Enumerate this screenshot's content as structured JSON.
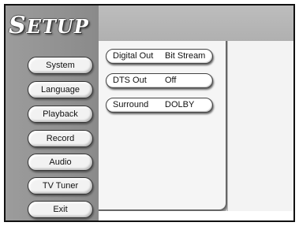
{
  "title": {
    "first": "S",
    "rest": "ETUP"
  },
  "menu": {
    "items": [
      {
        "label": "System"
      },
      {
        "label": "Language"
      },
      {
        "label": "Playback"
      },
      {
        "label": "Record"
      },
      {
        "label": "Audio"
      },
      {
        "label": "TV Tuner"
      },
      {
        "label": "Exit"
      }
    ]
  },
  "settings": [
    {
      "label": "Digital Out",
      "value": "Bit Stream"
    },
    {
      "label": "DTS Out",
      "value": "Off"
    },
    {
      "label": "Surround",
      "value": "DOLBY"
    }
  ]
}
